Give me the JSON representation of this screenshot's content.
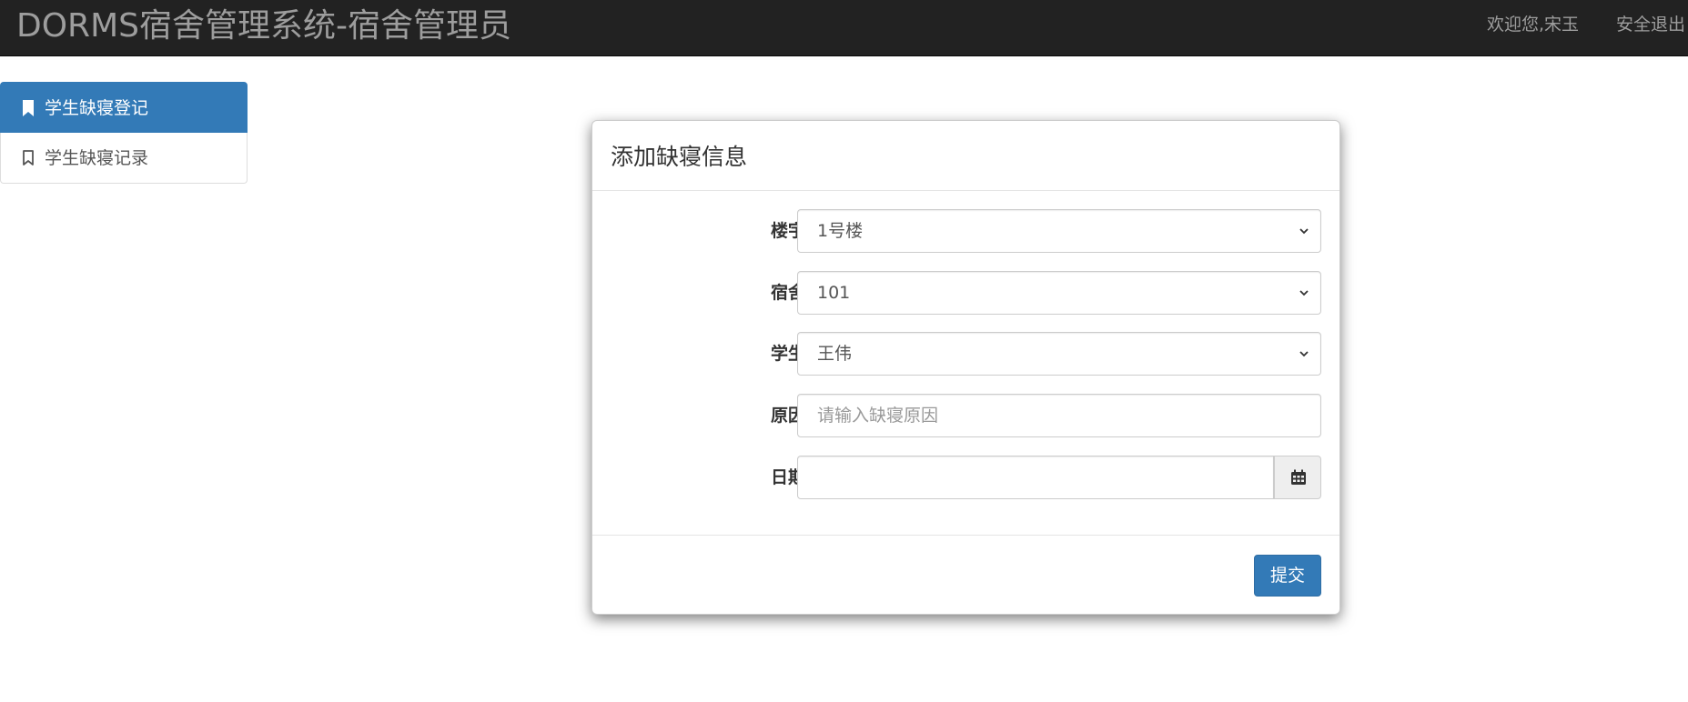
{
  "navbar": {
    "brand": "DORMS宿舍管理系统-宿舍管理员",
    "welcome": "欢迎您,宋玉",
    "logout": "安全退出"
  },
  "sidebar": {
    "items": [
      {
        "label": "学生缺寝登记",
        "active": true,
        "icon": "bookmark-icon"
      },
      {
        "label": "学生缺寝记录",
        "active": false,
        "icon": "bookmark-outline-icon"
      }
    ]
  },
  "modal": {
    "title": "添加缺寝信息",
    "fields": {
      "building": {
        "label": "楼宇",
        "value": "1号楼"
      },
      "dorm": {
        "label": "宿舍",
        "value": "101"
      },
      "student": {
        "label": "学生",
        "value": "王伟"
      },
      "reason": {
        "label": "原因",
        "value": "",
        "placeholder": "请输入缺寝原因"
      },
      "date": {
        "label": "日期",
        "value": "",
        "icon": "calendar-icon"
      }
    },
    "submit_label": "提交"
  },
  "colors": {
    "navbar_bg": "#222222",
    "primary": "#337ab7",
    "muted_text": "#9d9d9d"
  }
}
